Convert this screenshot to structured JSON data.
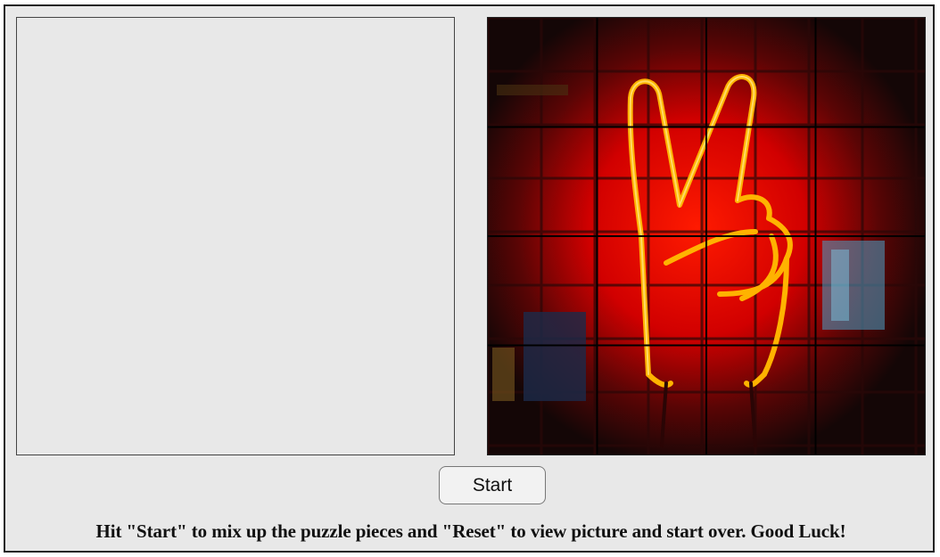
{
  "puzzle": {
    "rows": 4,
    "cols": 4,
    "picture_subject": "neon-peace-sign"
  },
  "controls": {
    "start_label": "Start"
  },
  "instructions": {
    "text": "Hit \"Start\" to mix up the puzzle pieces and \"Reset\" to view picture and start over. Good Luck!"
  },
  "colors": {
    "background": "#e8e8e8",
    "neon_glow": "#d90000",
    "neon_tube": "#ffb300",
    "grid_line": "#000000"
  }
}
